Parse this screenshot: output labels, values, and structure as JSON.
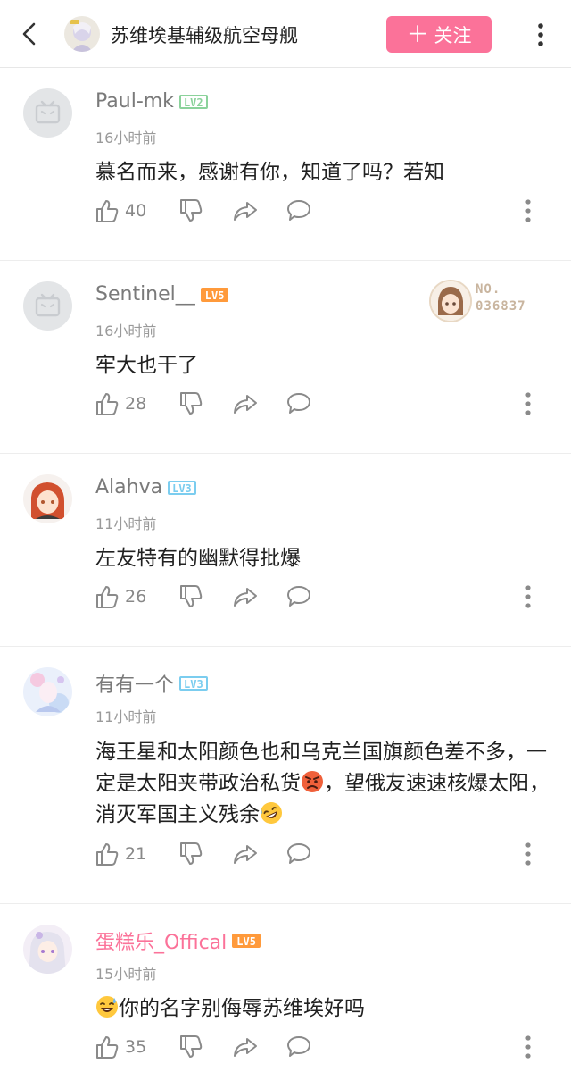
{
  "header": {
    "title": "苏维埃基辅级航空母舰",
    "follow_label": "关注",
    "follow_plus": "＋"
  },
  "colors": {
    "accent": "#fb7299",
    "lv2": "#8bd29b",
    "lv3": "#7bcdef",
    "lv5": "#ff9a3b"
  },
  "comments": [
    {
      "user": "Paul-mk",
      "level": "LV2",
      "time": "16小时前",
      "text": "慕名而来，感谢有你，知道了吗？若知",
      "likes": "40"
    },
    {
      "user": "Sentinel__",
      "level": "LV5",
      "time": "16小时前",
      "text": "牢大也干了",
      "likes": "28",
      "badge_no": "NO.",
      "badge_num": "036837"
    },
    {
      "user": "Alahva",
      "level": "LV3",
      "time": "11小时前",
      "text": "左友特有的幽默得批爆",
      "likes": "26"
    },
    {
      "user": "有有一个",
      "level": "LV3",
      "time": "11小时前",
      "text_a": "海王星和太阳颜色也和乌克兰国旗颜色差不多，一定是太阳夹带政治私货",
      "text_b": "，望俄友速速核爆太阳，消灭军国主义残余",
      "likes": "21",
      "emoji_1": "angry-face",
      "emoji_2": "rofl-face"
    },
    {
      "user": "蛋糕乐_Offical",
      "level": "LV5",
      "time": "15小时前",
      "text": "你的名字别侮辱苏维埃好吗",
      "likes": "35",
      "emoji_1": "sweat-smile-face"
    }
  ]
}
